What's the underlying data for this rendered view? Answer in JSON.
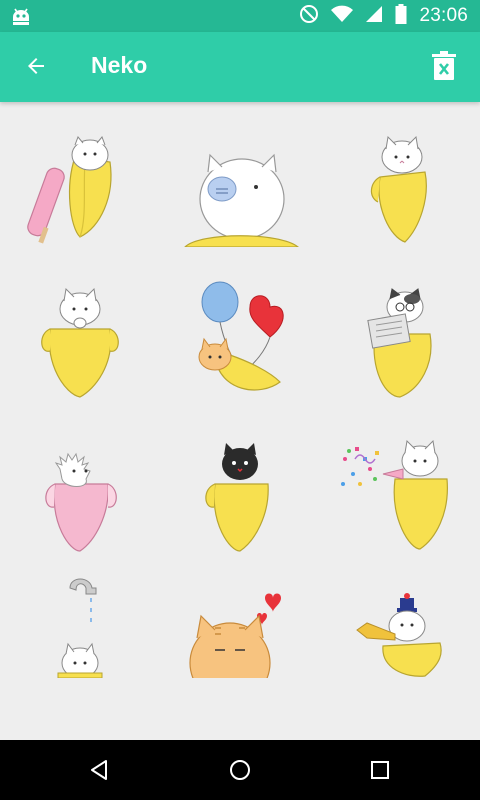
{
  "status_bar": {
    "time": "23:06",
    "icons": [
      "android-debug-icon",
      "do-not-disturb-icon",
      "wifi-icon",
      "cell-signal-icon",
      "battery-icon"
    ],
    "color": "#25b894"
  },
  "app_bar": {
    "title": "Neko",
    "color": "#2fcda8",
    "back_icon": "arrow-back-icon",
    "delete_icon": "delete-icon"
  },
  "stickers": [
    {
      "name": "cat-popsicle-banana"
    },
    {
      "name": "big-cat-banana"
    },
    {
      "name": "white-cat-banana"
    },
    {
      "name": "cat-praying-banana"
    },
    {
      "name": "orange-cat-balloons-banana"
    },
    {
      "name": "calico-cat-newspaper-banana"
    },
    {
      "name": "fluffy-cat-pink-banana"
    },
    {
      "name": "black-cat-banana"
    },
    {
      "name": "cat-confetti-banana"
    },
    {
      "name": "cat-faucet-banana"
    },
    {
      "name": "orange-tabby-hearts-banana"
    },
    {
      "name": "cat-trumpet-banana"
    }
  ],
  "nav_bar": {
    "icons": [
      "back-triangle-icon",
      "home-circle-icon",
      "recents-square-icon"
    ]
  }
}
